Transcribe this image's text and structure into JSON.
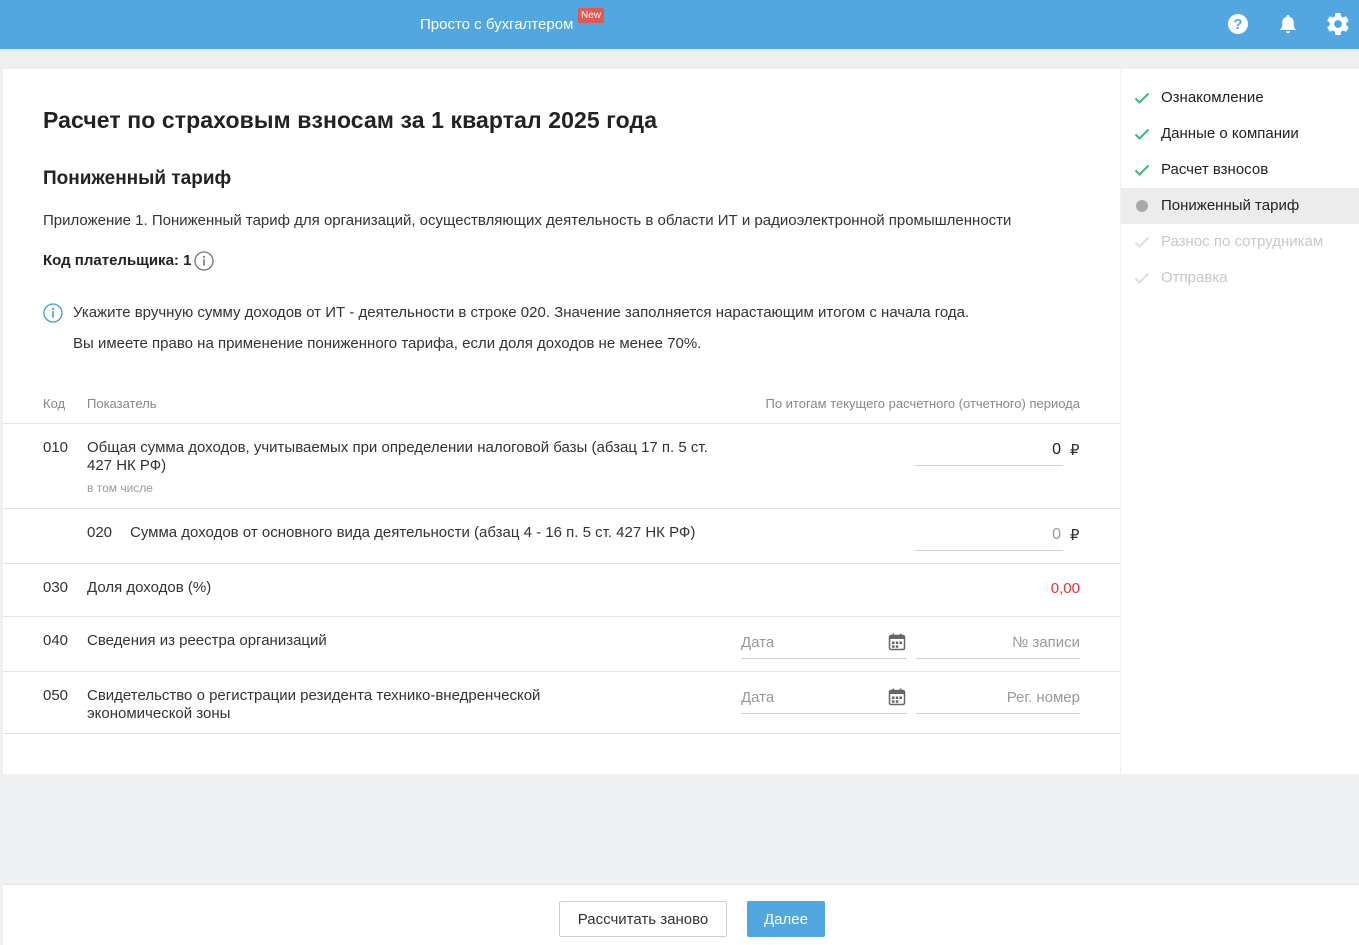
{
  "topbar": {
    "promo_text": "Просто с бухгалтером",
    "new_badge": "New",
    "icons": [
      "help-icon",
      "bell-icon",
      "gear-icon"
    ],
    "accent_color": "#52a7e0"
  },
  "main": {
    "title": "Расчет по страховым взносам за 1 квартал 2025 года",
    "section_title": "Пониженный тариф",
    "appendix": "Приложение 1. Пониженный тариф для организаций, осуществляющих деятельность в области ИТ и радиоэлектронной промышленности",
    "payer_code": "Код плательщика: 1",
    "notice": [
      "Укажите вручную сумму доходов от ИТ - деятельности в строке 020. Значение заполняется нарастающим итогом с начала года.",
      "Вы имеете право на применение пониженного тарифа, если доля доходов не менее 70%."
    ],
    "table": {
      "headers": {
        "code": "Код",
        "indicator": "Показатель",
        "period": "По итогам текущего расчетного (отчетного) периода"
      },
      "rows": [
        {
          "code": "010",
          "label_line1": "Общая сумма доходов, учитываемых при определении налоговой базы (абзац 17 п. 5 ст.",
          "label_line2": "427 НК РФ)",
          "sub": "в том числе",
          "value": "0",
          "currency": "₽"
        },
        {
          "code": "020",
          "label": "Сумма доходов от основного вида деятельности (абзац 4 - 16 п. 5 ст. 427 НК РФ)",
          "value": "0",
          "currency": "₽"
        },
        {
          "code": "030",
          "label": "Доля доходов (%)",
          "value": "0,00"
        },
        {
          "code": "040",
          "label": "Сведения из реестра организаций",
          "date_placeholder": "Дата",
          "number_placeholder": "№ записи"
        },
        {
          "code": "050",
          "label_line1": "Свидетельство о регистрации резидента технико-внедренческой",
          "label_line2": "экономической зоны",
          "date_placeholder": "Дата",
          "number_placeholder": "Рег. номер"
        }
      ]
    }
  },
  "sidebar": {
    "steps": [
      {
        "label": "Ознакомление",
        "state": "done"
      },
      {
        "label": "Данные о компании",
        "state": "done"
      },
      {
        "label": "Расчет взносов",
        "state": "done"
      },
      {
        "label": "Пониженный тариф",
        "state": "active"
      },
      {
        "label": "Разнос по сотрудникам",
        "state": "future"
      },
      {
        "label": "Отправка",
        "state": "future"
      }
    ]
  },
  "footer": {
    "recalc_label": "Рассчитать заново",
    "next_label": "Далее"
  }
}
